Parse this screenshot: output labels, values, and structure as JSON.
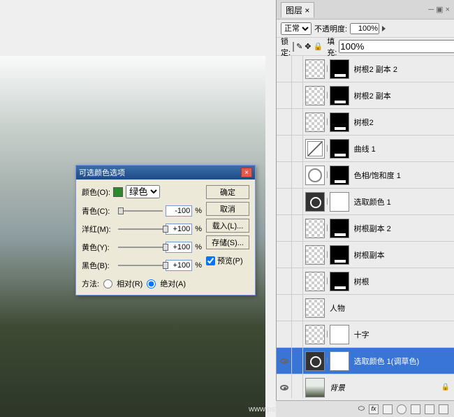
{
  "watermark": "www.psfeng.cn",
  "panel": {
    "tab": "图层",
    "close": "×",
    "blend_mode": "正常",
    "opacity_label": "不透明度:",
    "opacity_value": "100%",
    "lock_label": "锁定:",
    "fill_label": "填充:",
    "fill_value": "100%"
  },
  "layers": [
    {
      "name": "树根2 副本 2",
      "visible": false,
      "thumbs": [
        "checker",
        "mask"
      ]
    },
    {
      "name": "树根2 副本",
      "visible": false,
      "thumbs": [
        "checker",
        "mask"
      ]
    },
    {
      "name": "树根2",
      "visible": false,
      "thumbs": [
        "checker",
        "mask"
      ]
    },
    {
      "name": "曲线 1",
      "visible": false,
      "thumbs": [
        "curves",
        "mask"
      ]
    },
    {
      "name": "色相/饱和度 1",
      "visible": false,
      "thumbs": [
        "hsl",
        "mask"
      ]
    },
    {
      "name": "选取颜色 1",
      "visible": false,
      "thumbs": [
        "selcol",
        "white-mask"
      ]
    },
    {
      "name": "树根副本 2",
      "visible": false,
      "thumbs": [
        "checker",
        "mask"
      ]
    },
    {
      "name": "树根副本",
      "visible": false,
      "thumbs": [
        "checker",
        "mask"
      ]
    },
    {
      "name": "树根",
      "visible": false,
      "thumbs": [
        "checker",
        "mask"
      ]
    },
    {
      "name": "人物",
      "visible": false,
      "thumbs": [
        "checker"
      ]
    },
    {
      "name": "十字",
      "visible": false,
      "thumbs": [
        "checker",
        "white-mask"
      ]
    },
    {
      "name": "选取颜色 1(调草色)",
      "visible": true,
      "selected": true,
      "thumbs": [
        "selcol",
        "white-mask"
      ],
      "dim": true
    },
    {
      "name": "背景",
      "visible": true,
      "thumbs": [
        "img"
      ],
      "italic": true,
      "locked": true
    }
  ],
  "dialog": {
    "title": "可选颜色选项",
    "colors_label": "颜色(O):",
    "color_name": "绿色",
    "sliders": [
      {
        "label": "青色(C):",
        "value": "-100",
        "pos": 0
      },
      {
        "label": "洋红(M):",
        "value": "+100",
        "pos": 100
      },
      {
        "label": "黄色(Y):",
        "value": "+100",
        "pos": 100
      },
      {
        "label": "黑色(B):",
        "value": "+100",
        "pos": 100
      }
    ],
    "pct": "%",
    "method_label": "方法:",
    "method_rel": "相对(R)",
    "method_abs": "绝对(A)",
    "buttons": {
      "ok": "确定",
      "cancel": "取消",
      "load": "载入(L)...",
      "save": "存储(S)...",
      "preview": "预览(P)"
    }
  }
}
